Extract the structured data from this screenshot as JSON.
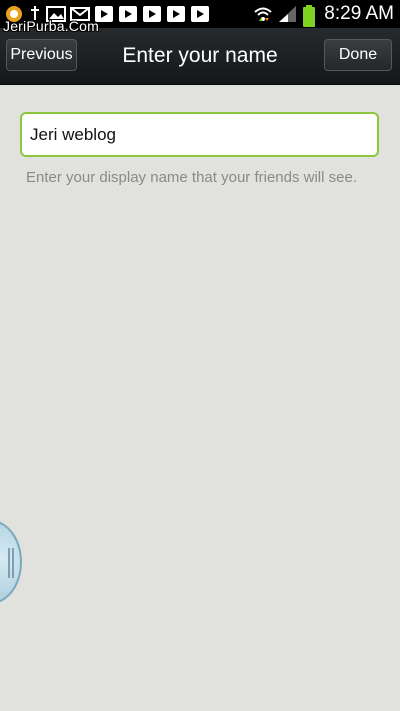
{
  "status_bar": {
    "watermark": "JeriPurba.Com",
    "time": "8:29 AM",
    "icons": [
      "app-notification-icon",
      "usb-icon",
      "image-icon",
      "email-icon",
      "play-store-icon",
      "play-store-icon",
      "play-store-icon",
      "play-store-icon",
      "play-store-icon",
      "wifi-icon",
      "signal-icon",
      "battery-icon"
    ]
  },
  "title_bar": {
    "title": "Enter your name",
    "previous_label": "Previous",
    "done_label": "Done"
  },
  "form": {
    "name_value": "Jeri weblog",
    "hint": "Enter your display name that your friends will see."
  },
  "colors": {
    "input_focus_border": "#8dc63f",
    "background": "#e1e1dd",
    "battery": "#7ed321"
  }
}
